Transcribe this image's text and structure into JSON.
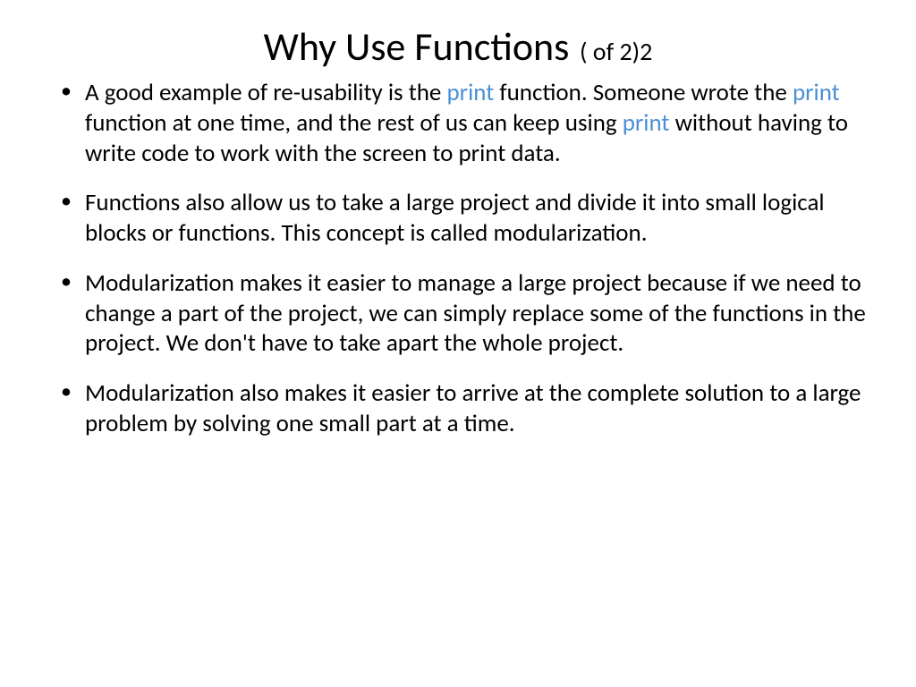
{
  "title": {
    "main": "Why Use Functions",
    "suffix": "( of 2)2"
  },
  "bullets": [
    {
      "segments": [
        {
          "text": "A good example of re-usability is the ",
          "highlight": false
        },
        {
          "text": "print",
          "highlight": true
        },
        {
          "text": " function. Someone wrote the ",
          "highlight": false
        },
        {
          "text": "print",
          "highlight": true
        },
        {
          "text": " function at one time, and the rest of us can keep using ",
          "highlight": false
        },
        {
          "text": "print",
          "highlight": true
        },
        {
          "text": " without having to write code to work with the screen to print data.",
          "highlight": false
        }
      ]
    },
    {
      "segments": [
        {
          "text": "Functions also allow us to take a large project and divide it into small logical blocks or functions. This concept is called modularization.",
          "highlight": false
        }
      ]
    },
    {
      "segments": [
        {
          "text": "Modularization makes it easier to manage a large project because if we need to change a part of the project, we can simply replace some of the functions in the project. We don't have to take apart the whole project.",
          "highlight": false
        }
      ]
    },
    {
      "segments": [
        {
          "text": " Modularization also makes it easier to arrive at the complete solution to a large problem by solving one small part at a time.",
          "highlight": false
        }
      ]
    }
  ]
}
